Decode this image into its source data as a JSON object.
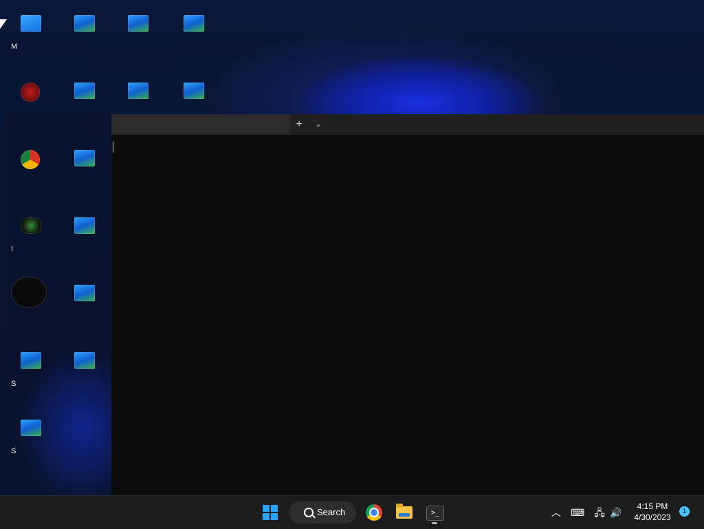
{
  "desktop": {
    "icons": [
      {
        "name": "desktop-icon-this-pc",
        "caption": "M",
        "kind": "app",
        "col": 0,
        "row": 0
      },
      {
        "name": "desktop-icon-1",
        "caption": "",
        "kind": "file",
        "col": 1,
        "row": 0
      },
      {
        "name": "desktop-icon-2",
        "caption": "",
        "kind": "file",
        "col": 2,
        "row": 0
      },
      {
        "name": "desktop-icon-3",
        "caption": "",
        "kind": "file",
        "col": 3,
        "row": 0
      },
      {
        "name": "desktop-icon-red-app",
        "caption": "",
        "kind": "red",
        "col": 0,
        "row": 1
      },
      {
        "name": "desktop-icon-4",
        "caption": "",
        "kind": "file",
        "col": 1,
        "row": 1
      },
      {
        "name": "desktop-icon-5",
        "caption": "",
        "kind": "file",
        "col": 2,
        "row": 1
      },
      {
        "name": "desktop-icon-6",
        "caption": "",
        "kind": "file",
        "col": 3,
        "row": 1
      },
      {
        "name": "desktop-icon-chrome",
        "caption": "",
        "kind": "chrome",
        "col": 0,
        "row": 2
      },
      {
        "name": "desktop-icon-7",
        "caption": "",
        "kind": "file",
        "col": 1,
        "row": 2
      },
      {
        "name": "desktop-icon-game",
        "caption": "I",
        "kind": "gamepad",
        "col": 0,
        "row": 3
      },
      {
        "name": "desktop-icon-8",
        "caption": "",
        "kind": "file",
        "col": 1,
        "row": 3
      },
      {
        "name": "desktop-icon-dark-app",
        "caption": "",
        "kind": "dark",
        "col": 0,
        "row": 4
      },
      {
        "name": "desktop-icon-9",
        "caption": "",
        "kind": "file",
        "col": 1,
        "row": 4
      },
      {
        "name": "desktop-icon-10",
        "caption": "S",
        "kind": "file",
        "col": 0,
        "row": 5
      },
      {
        "name": "desktop-icon-11",
        "caption": "",
        "kind": "file",
        "col": 1,
        "row": 5
      },
      {
        "name": "desktop-icon-12",
        "caption": "S",
        "kind": "file",
        "col": 0,
        "row": 6
      }
    ]
  },
  "terminal": {
    "tab_title": "",
    "new_tab_glyph": "+",
    "dropdown_glyph": "⌄"
  },
  "taskbar": {
    "search_label": "Search",
    "terminal_glyph": ">_",
    "tray": {
      "chevron": "︿",
      "keyboard": "⌨",
      "network": "🖧",
      "volume": "🔊"
    },
    "time": "4:15 PM",
    "date": "4/30/2023",
    "notification_count": "1"
  }
}
